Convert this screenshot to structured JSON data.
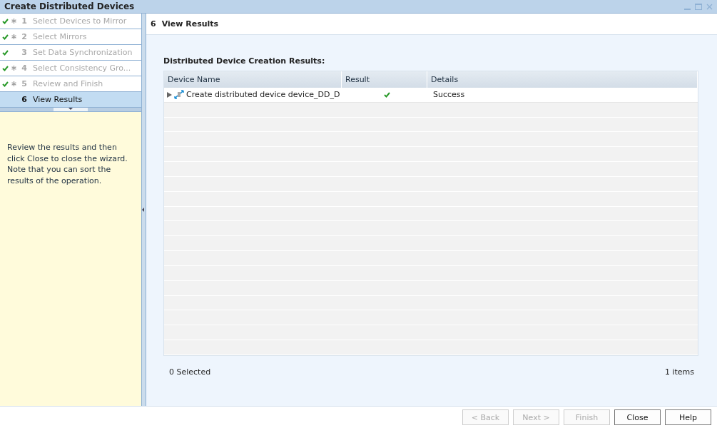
{
  "window": {
    "title": "Create Distributed Devices"
  },
  "steps": [
    {
      "number": "1",
      "label": "Select Devices to Mirror",
      "completed": true,
      "required": true,
      "selected": false
    },
    {
      "number": "2",
      "label": "Select Mirrors",
      "completed": true,
      "required": true,
      "selected": false
    },
    {
      "number": "3",
      "label": "Set Data Synchronization",
      "completed": true,
      "required": false,
      "selected": false
    },
    {
      "number": "4",
      "label": "Select Consistency Gro...",
      "completed": true,
      "required": true,
      "selected": false
    },
    {
      "number": "5",
      "label": "Review and Finish",
      "completed": true,
      "required": true,
      "selected": false
    },
    {
      "number": "6",
      "label": "View Results",
      "completed": false,
      "required": false,
      "selected": true
    }
  ],
  "help_text": "Review the results and then click Close to close the wizard. Note that you can sort the results of the operation.",
  "page": {
    "number": "6",
    "title": "View Results"
  },
  "results": {
    "title": "Distributed Device Creation Results:",
    "columns": [
      "Device Name",
      "Result",
      "Details"
    ],
    "rows": [
      {
        "device_name": "Create distributed device device_DD_D",
        "succeeded": true,
        "details": "Success",
        "expanded": false
      }
    ],
    "selected_count": "0 Selected",
    "item_count": "1 items"
  },
  "buttons": [
    {
      "label": "< Back",
      "disabled": true
    },
    {
      "label": "Next >",
      "disabled": true
    },
    {
      "label": "Finish",
      "disabled": true
    },
    {
      "label": "Close",
      "disabled": false
    },
    {
      "label": "Help",
      "disabled": false
    }
  ]
}
